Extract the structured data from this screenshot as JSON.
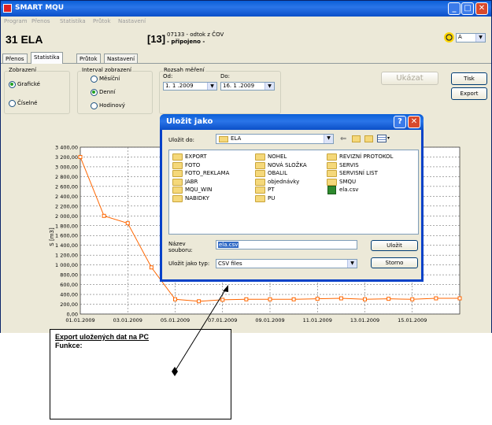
{
  "app": {
    "title": "SMART MQU"
  },
  "menu": [
    "Program",
    "Přenos",
    "Statistika",
    "Průtok",
    "Nastavení"
  ],
  "header": {
    "station": "31 ELA",
    "number": "[13]",
    "desc_line1": "07133 - odtok z ČOV",
    "desc_line2": "- připojeno -",
    "user": "A"
  },
  "tabs": [
    "Přenos",
    "Statistika",
    "Průtok",
    "Nastavení"
  ],
  "display": {
    "label": "Zobrazení",
    "options": [
      "Grafické",
      "Číselné"
    ],
    "selected": "Grafické"
  },
  "interval": {
    "label": "Interval zobrazení",
    "options": [
      "Měsíční",
      "Denní",
      "Hodinový"
    ],
    "selected": "Denní"
  },
  "range": {
    "label": "Rozsah měření",
    "from_label": "Od:",
    "to_label": "Do:",
    "from": "1. 1 .2009",
    "to": "16. 1 .2009"
  },
  "buttons": {
    "show": "Ukázat",
    "print": "Tisk",
    "export": "Export"
  },
  "chart_data": {
    "type": "line",
    "ylabel": "S [m3]",
    "ylim": [
      0,
      3400
    ],
    "yticks": [
      "0,00",
      "200,00",
      "400,00",
      "600,00",
      "800,00",
      "1 000,00",
      "1 200,00",
      "1 400,00",
      "1 600,00",
      "1 800,00",
      "2 000,00",
      "2 200,00",
      "2 400,00",
      "2 600,00",
      "2 800,00",
      "3 000,00",
      "3 200,00",
      "3 400,00"
    ],
    "xticks": [
      "01.01.2009",
      "03.01.2009",
      "05.01.2009",
      "07.01.2009",
      "09.01.2009",
      "11.01.2009",
      "13.01.2009",
      "15.01.2009"
    ],
    "x": [
      1,
      2,
      3,
      4,
      5,
      6,
      7,
      8,
      9,
      10,
      11,
      12,
      13,
      14,
      15,
      16,
      17
    ],
    "values": [
      3200,
      2000,
      1850,
      950,
      300,
      260,
      290,
      300,
      300,
      300,
      310,
      320,
      300,
      310,
      300,
      320,
      320
    ],
    "color": "#ff6600"
  },
  "dialog": {
    "title": "Uložit jako",
    "save_in_label": "Uložit do:",
    "save_in_value": "ELA",
    "files": [
      {
        "name": "EXPORT",
        "type": "folder"
      },
      {
        "name": "FOTO",
        "type": "folder"
      },
      {
        "name": "FOTO_REKLAMA",
        "type": "folder"
      },
      {
        "name": "JABR",
        "type": "folder"
      },
      {
        "name": "MQU_WIN",
        "type": "folder"
      },
      {
        "name": "NABIDKY",
        "type": "folder"
      },
      {
        "name": "NOHEL",
        "type": "folder"
      },
      {
        "name": "NOVÁ SLOŽKA",
        "type": "folder"
      },
      {
        "name": "OBALIL",
        "type": "folder"
      },
      {
        "name": "objednávky",
        "type": "folder"
      },
      {
        "name": "PT",
        "type": "folder"
      },
      {
        "name": "PU",
        "type": "folder"
      },
      {
        "name": "REVIZNÍ PROTOKOL",
        "type": "folder"
      },
      {
        "name": "SERVIS",
        "type": "folder"
      },
      {
        "name": "SERVISNÍ LIST",
        "type": "folder"
      },
      {
        "name": "SMQU",
        "type": "folder"
      },
      {
        "name": "ela.csv",
        "type": "csv"
      }
    ],
    "filename_label1": "Název",
    "filename_label2": "souboru:",
    "filename": "ela.csv",
    "filetype_label": "Uložit jako typ:",
    "filetype": "CSV files",
    "save": "Uložit",
    "cancel": "Storno"
  },
  "annotation": {
    "title": "Export uložených dat na PC",
    "subtitle": "Funkce:"
  }
}
